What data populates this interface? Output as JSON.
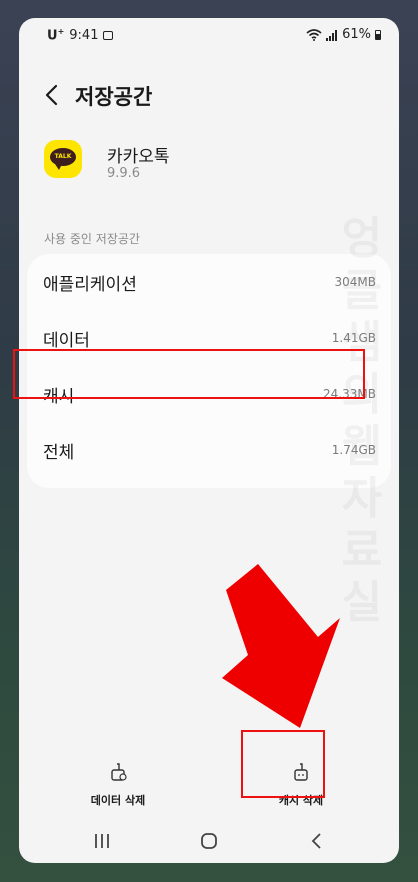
{
  "status_bar": {
    "carrier": "U",
    "carrier_sup": "+",
    "time": "9:41",
    "battery": "61%"
  },
  "header": {
    "title": "저장공간"
  },
  "app": {
    "name": "카카오톡",
    "version": "9.9.6",
    "icon_text": "TALK"
  },
  "section_label": "사용 중인 저장공간",
  "storage_rows": [
    {
      "label": "애플리케이션",
      "value": "304MB"
    },
    {
      "label": "데이터",
      "value": "1.41GB"
    },
    {
      "label": "캐시",
      "value": "24.33MB"
    },
    {
      "label": "전체",
      "value": "1.74GB"
    }
  ],
  "actions": {
    "clear_data": "데이터 삭제",
    "clear_cache": "캐시 삭제"
  },
  "watermark": "엉클샘의웹자료실",
  "colors": {
    "highlight": "#ee1111",
    "arrow": "#ee0000",
    "kakao_yellow": "#fde500"
  },
  "icons": [
    "back-icon",
    "wifi-icon",
    "signal-icon",
    "battery-icon",
    "image-icon",
    "broom-icon",
    "recent-apps-icon",
    "home-icon",
    "nav-back-icon"
  ]
}
